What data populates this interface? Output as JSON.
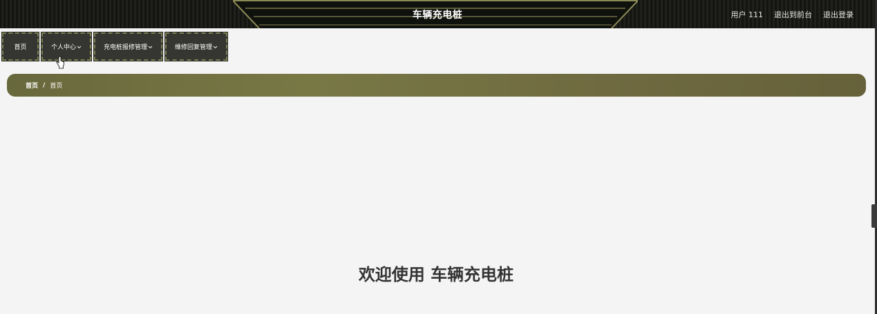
{
  "header": {
    "title": "车辆充电桩",
    "user_label": "用户 111",
    "front_link": "退出到前台",
    "logout_link": "退出登录"
  },
  "nav": {
    "home": "首页",
    "personal": "个人中心",
    "repair": "充电桩报修管理",
    "reply": "维修回复管理"
  },
  "breadcrumb": {
    "home": "首页",
    "separator": "/",
    "current": "首页"
  },
  "main": {
    "welcome": "欢迎使用 车辆充电桩"
  },
  "icons": {
    "nav_dropdown": "chevron-down-icon",
    "cursor": "hand-pointer-icon"
  },
  "colors": {
    "header_bg": "#151512",
    "nav_bg": "#353531",
    "nav_border": "#7b7f52",
    "breadcrumb_bg": "#737342",
    "page_bg": "#f4f4f4",
    "welcome_text": "#333333"
  }
}
